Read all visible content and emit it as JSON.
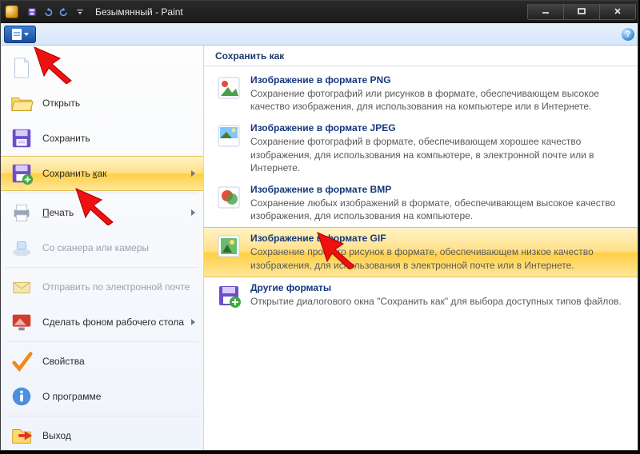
{
  "window": {
    "title": "Безымянный - Paint"
  },
  "help_icon_char": "?",
  "menu": {
    "new": "Открыть",
    "save": "Сохранить",
    "save_as": "Сохранить как",
    "save_as_u": "к",
    "print": "Печать",
    "print_u": "П",
    "scanner": "Со сканера или камеры",
    "email": "Отправить по электронной почте",
    "desktop": "Сделать фоном рабочего стола",
    "properties": "Свойства",
    "about": "О программе",
    "exit": "Выход"
  },
  "pane": {
    "header": "Сохранить как",
    "formats": [
      {
        "title": "Изображение в формате PNG",
        "desc": "Сохранение фотографий или рисунков в формате, обеспечивающем высокое качество изображения, для использования на компьютере или в Интернете."
      },
      {
        "title": "Изображение в формате JPEG",
        "desc": "Сохранение фотографий в формате, обеспечивающем хорошее качество изображения, для использования на компьютере, в электронной почте или в Интернете."
      },
      {
        "title": "Изображение в формате BMP",
        "desc": "Сохранение любых изображений в формате, обеспечивающем высокое качество изображения, для использования на компьютере."
      },
      {
        "title": "Изображение в формате GIF",
        "desc": "Сохранение простого рисунок в формате, обеспечивающем низкое качество изображения, для использования в электронной почте или в Интернете."
      },
      {
        "title": "Другие форматы",
        "desc": "Открытие диалогового окна \"Сохранить как\" для выбора доступных типов файлов."
      }
    ]
  }
}
